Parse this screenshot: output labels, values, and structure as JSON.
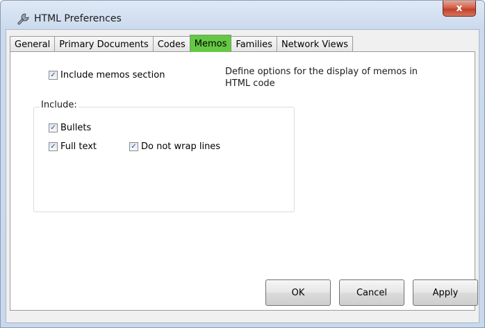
{
  "window": {
    "title": "HTML Preferences",
    "close_glyph": "x",
    "app_icon": "wrench-icon"
  },
  "tabs": [
    {
      "label": "General",
      "active": false
    },
    {
      "label": "Primary Documents",
      "active": false
    },
    {
      "label": "Codes",
      "active": false
    },
    {
      "label": "Memos",
      "active": true
    },
    {
      "label": "Families",
      "active": false
    },
    {
      "label": "Network Views",
      "active": false
    }
  ],
  "memos": {
    "include_memos_section": {
      "label": "Include memos section",
      "checked": true
    },
    "description": "Define options for the display of memos in HTML code",
    "group_label": "Include:",
    "bullets": {
      "label": "Bullets",
      "checked": true
    },
    "full_text": {
      "label": "Full text",
      "checked": true
    },
    "do_not_wrap": {
      "label": "Do not wrap lines",
      "checked": true
    }
  },
  "buttons": {
    "ok": "OK",
    "cancel": "Cancel",
    "apply": "Apply"
  },
  "colors": {
    "active_tab": "#64c843",
    "close_button": "#c94a33"
  }
}
